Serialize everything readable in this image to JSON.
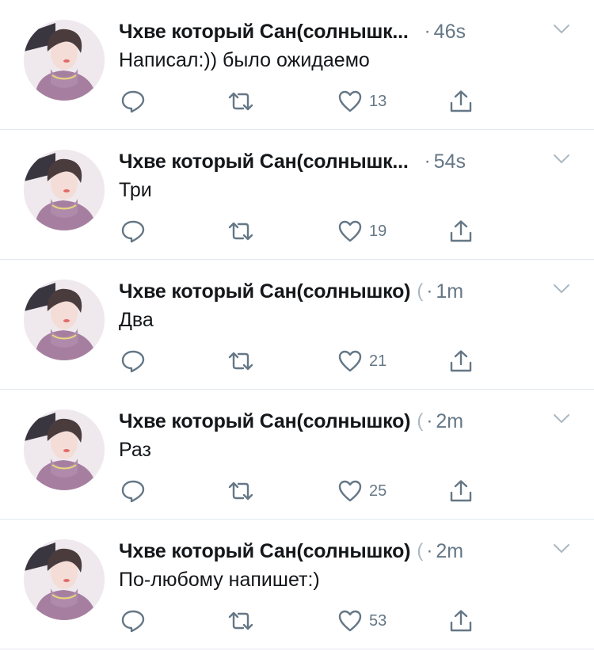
{
  "tweets": [
    {
      "name": "Чхве который Сан(солнышк...",
      "handle_frag": "",
      "time": "46s",
      "text": "Написал:)) было ожидаемо",
      "likes": "13"
    },
    {
      "name": "Чхве который Сан(солнышк...",
      "handle_frag": "",
      "time": "54s",
      "text": "Три",
      "likes": "19"
    },
    {
      "name": "Чхве который Сан(солнышко)",
      "handle_frag": "(",
      "time": "1m",
      "text": "Два",
      "likes": "21"
    },
    {
      "name": "Чхве который Сан(солнышко)",
      "handle_frag": "(",
      "time": "2m",
      "text": "Раз",
      "likes": "25"
    },
    {
      "name": "Чхве который Сан(солнышко)",
      "handle_frag": "(",
      "time": "2m",
      "text": "По-любому напишет:)",
      "likes": "53"
    }
  ],
  "separator": "·",
  "colors": {
    "text": "#14171a",
    "muted": "#657786",
    "border": "#e1e8ed",
    "sweater": "#a67fa0"
  },
  "icons": [
    "reply-icon",
    "retweet-icon",
    "heart-icon",
    "share-icon",
    "chevron-down-icon"
  ]
}
